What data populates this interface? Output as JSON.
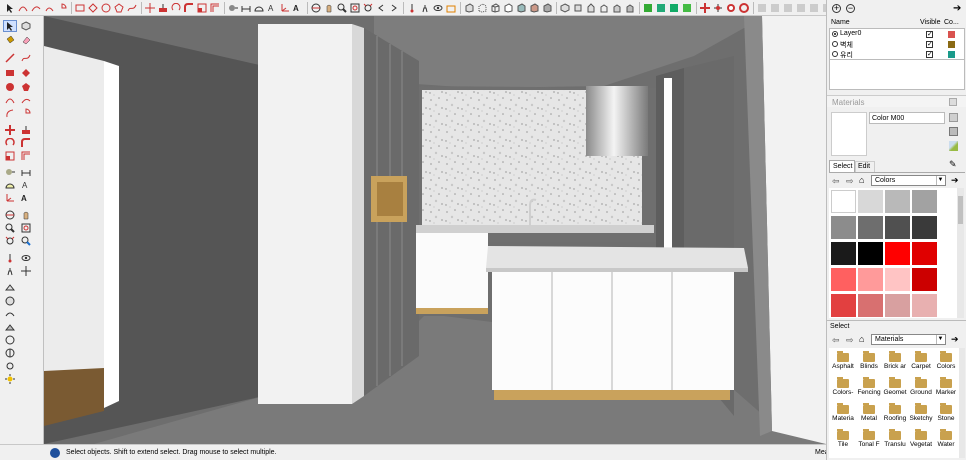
{
  "status_bar": {
    "hint": "Select objects. Shift to extend select. Drag mouse to select multiple.",
    "measurements_label": "Mea"
  },
  "layers": {
    "headers": [
      "Name",
      "Visible",
      "Co..."
    ],
    "rows": [
      {
        "name": "Layer0",
        "active": true,
        "visible": true,
        "color": "#d9534f"
      },
      {
        "name": "벽체",
        "active": false,
        "visible": true,
        "color": "#8a6a14"
      },
      {
        "name": "유리",
        "active": false,
        "visible": true,
        "color": "#1a9a8a"
      }
    ]
  },
  "materials": {
    "panel_title": "Materials",
    "current_name": "Color M00",
    "tabs": [
      "Select",
      "Edit"
    ],
    "library": "Colors",
    "swatches": [
      "#ffffff",
      "#d8d8d8",
      "#b9b9b9",
      "#a2a2a2",
      "#8c8c8c",
      "#6e6e6e",
      "#505050",
      "#3a3a3a",
      "#1a1a1a",
      "#000000",
      "#ff0000",
      "#e00000",
      "#ff6060",
      "#ff9a9a",
      "#ffc4c4",
      "#cc0000",
      "#e24040",
      "#d87070",
      "#d8a0a0",
      "#e8b0b0"
    ]
  },
  "secondary_select": {
    "title": "Select",
    "library": "Materials",
    "folders": [
      "Asphalt",
      "Blinds",
      "Brick ar",
      "Carpet",
      "Colors",
      "Colors-",
      "Fencing",
      "Geomet",
      "Ground",
      "Marker",
      "Materia",
      "Metal",
      "Roofing",
      "Sketchy",
      "Stone",
      "Tile",
      "Tonal F",
      "Translu",
      "Vegetat",
      "Water"
    ]
  }
}
